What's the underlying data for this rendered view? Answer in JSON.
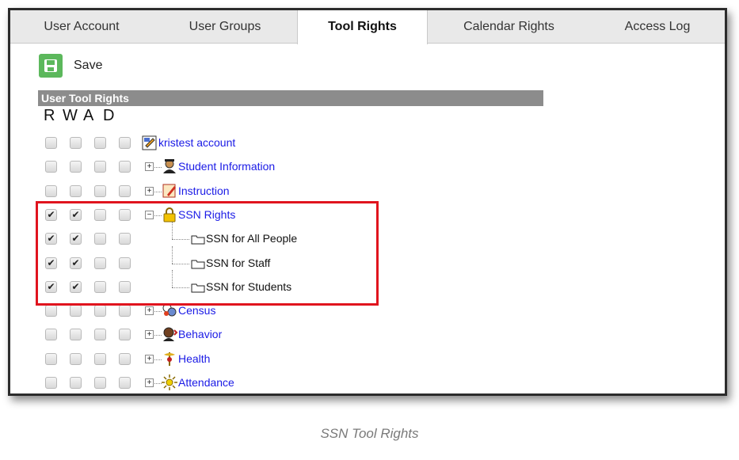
{
  "tabs": [
    {
      "label": "User Account",
      "active": false
    },
    {
      "label": "User Groups",
      "active": false
    },
    {
      "label": "Tool Rights",
      "active": true
    },
    {
      "label": "Calendar Rights",
      "active": false
    },
    {
      "label": "Access Log",
      "active": false
    }
  ],
  "toolbar": {
    "save_label": "Save",
    "save_icon": "floppy-disk-icon",
    "save_color": "#5cb85c"
  },
  "section": {
    "title": "User Tool Rights"
  },
  "rights_headers": [
    "R",
    "W",
    "A",
    "D"
  ],
  "tree": [
    {
      "label": "kristest account",
      "icon": "account-edit-icon",
      "checks": [
        false,
        false,
        false,
        false
      ],
      "expander": "",
      "link": true
    },
    {
      "label": "Student Information",
      "icon": "student-icon",
      "checks": [
        false,
        false,
        false,
        false
      ],
      "expander": "+",
      "link": true
    },
    {
      "label": "Instruction",
      "icon": "instruction-notebook-icon",
      "checks": [
        false,
        false,
        false,
        false
      ],
      "expander": "+",
      "link": true
    },
    {
      "label": "SSN Rights",
      "icon": "padlock-icon",
      "checks": [
        true,
        true,
        false,
        false
      ],
      "expander": "−",
      "link": true
    },
    {
      "label": "SSN for All People",
      "icon": "folder-tab-icon",
      "checks": [
        true,
        true,
        false,
        false
      ],
      "expander": "",
      "link": false,
      "child": true
    },
    {
      "label": "SSN for Staff",
      "icon": "folder-tab-icon",
      "checks": [
        true,
        true,
        false,
        false
      ],
      "expander": "",
      "link": false,
      "child": true
    },
    {
      "label": "SSN for Students",
      "icon": "folder-tab-icon",
      "checks": [
        true,
        true,
        false,
        false
      ],
      "expander": "",
      "link": false,
      "child": true
    },
    {
      "label": "Census",
      "icon": "census-people-icon",
      "checks": [
        false,
        false,
        false,
        false
      ],
      "expander": "+",
      "link": true
    },
    {
      "label": "Behavior",
      "icon": "behavior-icon",
      "checks": [
        false,
        false,
        false,
        false
      ],
      "expander": "+",
      "link": true
    },
    {
      "label": "Health",
      "icon": "caduceus-icon",
      "checks": [
        false,
        false,
        false,
        false
      ],
      "expander": "+",
      "link": true
    },
    {
      "label": "Attendance",
      "icon": "attendance-sun-icon",
      "checks": [
        false,
        false,
        false,
        false
      ],
      "expander": "+",
      "link": true
    }
  ],
  "highlight_color": "#e0141e",
  "caption": "SSN Tool Rights"
}
